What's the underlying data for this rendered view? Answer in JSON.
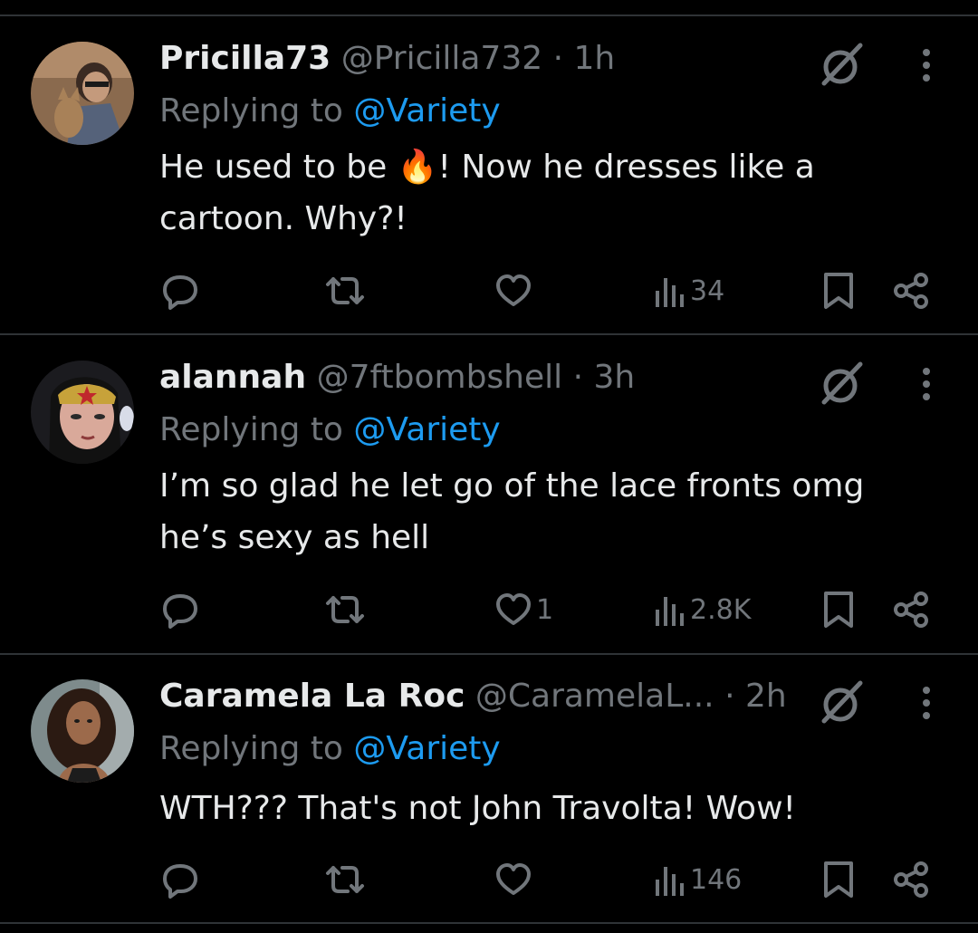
{
  "reply_prefix": "Replying to",
  "tweets": [
    {
      "name": "Pricilla73",
      "handle": "@Pricilla732",
      "separator": "·",
      "time": "1h",
      "reply_to": "@Variety",
      "text_before_emoji": "He used to be ",
      "emoji": "🔥",
      "text_after_emoji": "! Now he dresses like a cartoon. Why?!",
      "likes": "",
      "views": "34",
      "avatar": "avatar-photo-woman-with-dog"
    },
    {
      "name": "alannah",
      "handle": "@7ftbombshell",
      "separator": "·",
      "time": "3h",
      "reply_to": "@Variety",
      "text": "I’m so glad he let go of the lace fronts omg he’s sexy as hell",
      "likes": "1",
      "views": "2.8K",
      "avatar": "avatar-cartoon-wonder-woman"
    },
    {
      "name": "Caramela La Roc",
      "handle": "@CaramelaL...",
      "separator": "·",
      "time": "2h",
      "reply_to": "@Variety",
      "text": "WTH??? That's not John Travolta! Wow!",
      "likes": "",
      "views": "146",
      "avatar": "avatar-photo-woman-curly-hair"
    }
  ],
  "colors": {
    "background": "#000000",
    "text": "#e7e9ea",
    "muted": "#71767b",
    "link": "#1d9bf0",
    "divider": "#2f3336"
  }
}
